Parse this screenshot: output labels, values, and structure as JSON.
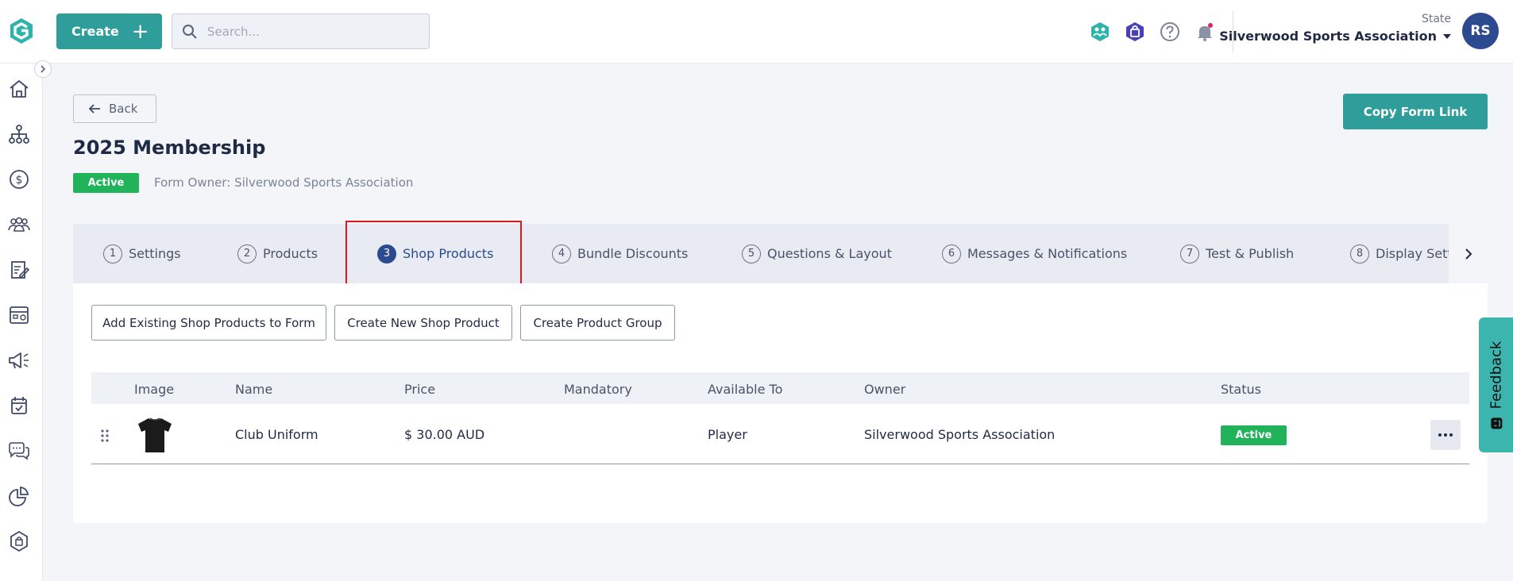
{
  "header": {
    "create_label": "Create",
    "search_placeholder": "Search...",
    "org_state": "State",
    "org_name": "Silverwood Sports Association",
    "avatar_initials": "RS"
  },
  "sidebar": {
    "items": [
      "home-icon",
      "org-tree-icon",
      "finance-icon",
      "members-icon",
      "forms-icon",
      "competitions-icon",
      "marketing-icon",
      "events-icon",
      "communications-icon",
      "reports-icon",
      "shop-icon"
    ]
  },
  "page": {
    "back_label": "Back",
    "copy_link_label": "Copy Form Link",
    "title": "2025 Membership",
    "status": "Active",
    "form_owner": "Form Owner: Silverwood Sports Association"
  },
  "tabs": [
    {
      "num": "1",
      "label": "Settings"
    },
    {
      "num": "2",
      "label": "Products"
    },
    {
      "num": "3",
      "label": "Shop Products",
      "active": true
    },
    {
      "num": "4",
      "label": "Bundle Discounts"
    },
    {
      "num": "5",
      "label": "Questions & Layout"
    },
    {
      "num": "6",
      "label": "Messages & Notifications"
    },
    {
      "num": "7",
      "label": "Test & Publish"
    },
    {
      "num": "8",
      "label": "Display Sett"
    }
  ],
  "actions": {
    "add_existing": "Add Existing Shop Products to Form",
    "create_new": "Create New Shop Product",
    "create_group": "Create Product Group"
  },
  "table": {
    "columns": [
      "Image",
      "Name",
      "Price",
      "Mandatory",
      "Available To",
      "Owner",
      "Status"
    ],
    "rows": [
      {
        "name": "Club Uniform",
        "price": "$ 30.00 AUD",
        "mandatory": "",
        "available_to": "Player",
        "owner": "Silverwood Sports Association",
        "status": "Active"
      }
    ]
  },
  "feedback_label": "Feedback",
  "colors": {
    "brand_teal": "#2f9e9a",
    "navy": "#2c4a8f",
    "active_green": "#21b35a",
    "highlight_red": "#e0171f"
  }
}
